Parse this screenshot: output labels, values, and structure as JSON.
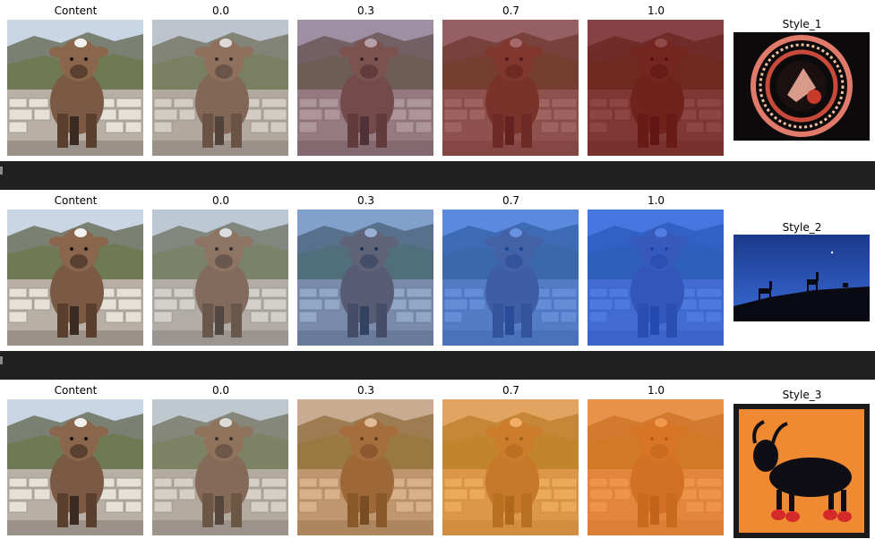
{
  "rows": [
    {
      "labels": [
        "Content",
        "0.0",
        "0.3",
        "0.7",
        "1.0"
      ],
      "style_label": "Style_1",
      "style_icon": "mandala-painting-icon",
      "tints": [
        "none",
        "#9a8f8a",
        "#6a3a55",
        "#7a1f1f",
        "#6e1010"
      ]
    },
    {
      "labels": [
        "Content",
        "0.0",
        "0.3",
        "0.7",
        "1.0"
      ],
      "style_label": "Style_2",
      "style_icon": "deer-silhouette-night-icon",
      "tints": [
        "none",
        "#9aa0a8",
        "#2d5fb0",
        "#1f5fd8",
        "#1b55e0"
      ]
    },
    {
      "labels": [
        "Content",
        "0.0",
        "0.3",
        "0.7",
        "1.0"
      ],
      "style_label": "Style_3",
      "style_icon": "goat-folk-art-icon",
      "tints": [
        "none",
        "#a39a90",
        "#c8782a",
        "#f08a1a",
        "#f07a18"
      ]
    }
  ],
  "colors": {
    "separator": "#202020",
    "background": "#ffffff"
  }
}
